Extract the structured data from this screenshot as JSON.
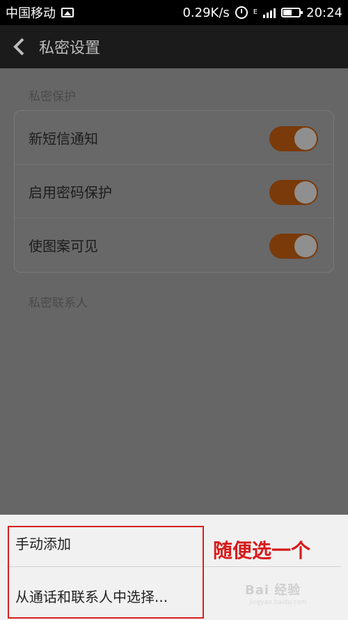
{
  "status_bar": {
    "carrier": "中国移动",
    "speed": "0.29K/s",
    "network_letter": "E",
    "time": "20:24",
    "icons": [
      "image-icon",
      "alarm-icon",
      "signal-icon",
      "battery-icon"
    ]
  },
  "header": {
    "title": "私密设置",
    "back_icon": "chevron-left-icon"
  },
  "sections": {
    "privacy_protection": "私密保护",
    "private_contacts": "私密联系人"
  },
  "settings": [
    {
      "label": "新短信通知",
      "enabled": true
    },
    {
      "label": "启用密码保护",
      "enabled": true
    },
    {
      "label": "使图案可见",
      "enabled": true
    }
  ],
  "bottom_sheet": {
    "items": [
      "手动添加",
      "从通话和联系人中选择..."
    ]
  },
  "annotation": "随便选一个",
  "watermark": {
    "logo": "Bai 经验",
    "url": "jingyan.baidu.com"
  },
  "colors": {
    "toggle_on": "#7a3a0a",
    "annotation": "#d81a1a"
  }
}
